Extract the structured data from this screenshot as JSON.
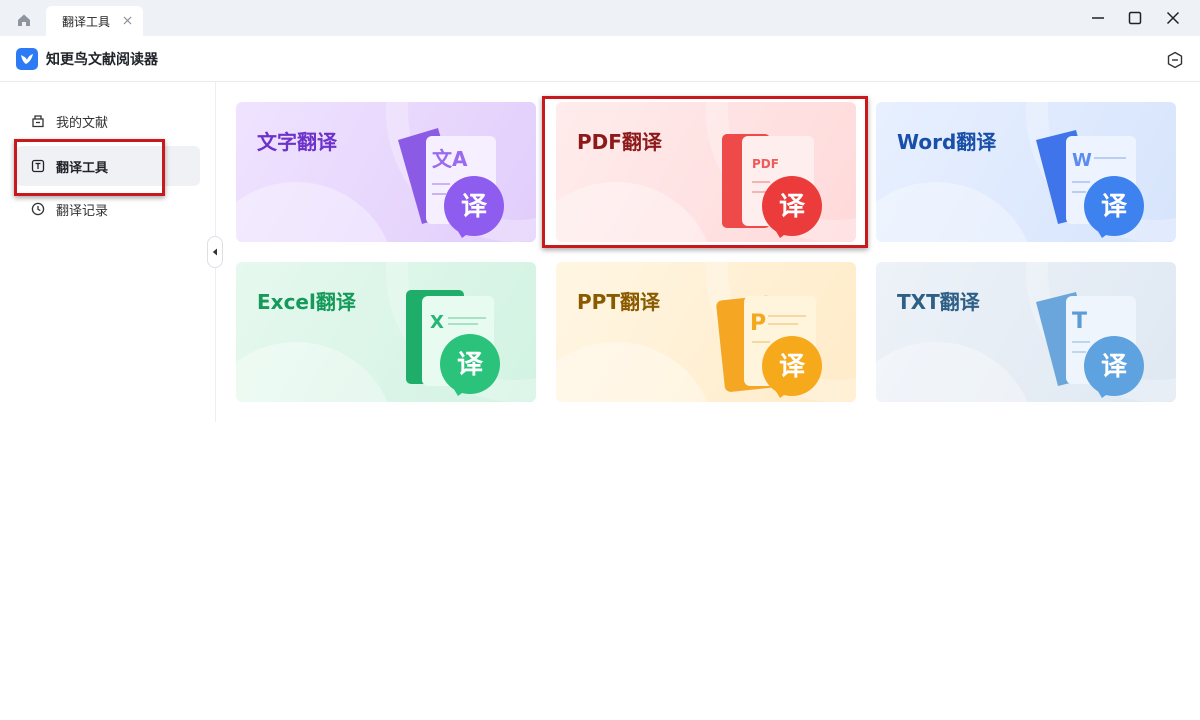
{
  "tabbar": {
    "tab_label": "翻译工具"
  },
  "app": {
    "title": "知更鸟文献阅读器"
  },
  "sidebar": {
    "items": [
      {
        "label": "我的文献",
        "icon": "library-icon",
        "active": false
      },
      {
        "label": "翻译工具",
        "icon": "translate-tool-icon",
        "active": true
      },
      {
        "label": "翻译记录",
        "icon": "clock-icon",
        "active": false
      }
    ]
  },
  "cards": [
    {
      "title": "文字翻译",
      "badge": "译",
      "doc_letter": "文A",
      "title_color": "#6c32c9"
    },
    {
      "title": "PDF翻译",
      "badge": "译",
      "doc_letter": "PDF",
      "title_color": "#8c1a1a"
    },
    {
      "title": "Word翻译",
      "badge": "译",
      "doc_letter": "W",
      "title_color": "#1a4fa8"
    },
    {
      "title": "Excel翻译",
      "badge": "译",
      "doc_letter": "X",
      "title_color": "#159a5a"
    },
    {
      "title": "PPT翻译",
      "badge": "译",
      "doc_letter": "P",
      "title_color": "#8a5a00"
    },
    {
      "title": "TXT翻译",
      "badge": "译",
      "doc_letter": "T",
      "title_color": "#2e5f86"
    }
  ],
  "colors": {
    "highlight_box": "#c8191c",
    "brand_blue": "#2d7bf4"
  }
}
